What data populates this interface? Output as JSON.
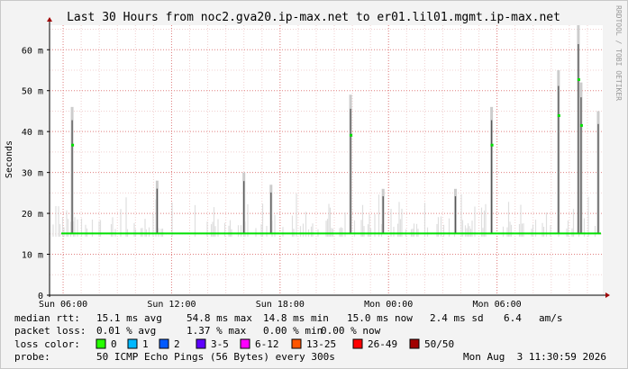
{
  "chart_data": {
    "type": "area",
    "title": "Last 30 Hours from noc2.gva20.ip-max.net to er01.lil01.mgmt.ip-max.net",
    "ylabel": "Seconds",
    "credit": "RRDTOOL / TOBI OETIKER",
    "ylim": [
      0,
      0.066
    ],
    "y_ticks": [
      {
        "value": 0,
        "label": "0"
      },
      {
        "value": 0.01,
        "label": "10 m"
      },
      {
        "value": 0.02,
        "label": "20 m"
      },
      {
        "value": 0.03,
        "label": "30 m"
      },
      {
        "value": 0.04,
        "label": "40 m"
      },
      {
        "value": 0.05,
        "label": "50 m"
      },
      {
        "value": 0.06,
        "label": "60 m"
      }
    ],
    "x_ticks": [
      {
        "hour": 0,
        "label": "Sun 06:00"
      },
      {
        "hour": 6,
        "label": "Sun 12:00"
      },
      {
        "hour": 12,
        "label": "Sun 18:00"
      },
      {
        "hour": 18,
        "label": "Mon 00:00"
      },
      {
        "hour": 24,
        "label": "Mon 06:00"
      }
    ],
    "x_range_hours": [
      -0.75,
      29.85
    ],
    "median_series": {
      "name": "median rtt",
      "color": "#00e000",
      "baseline": 0.0151
    },
    "spikes": [
      {
        "hour": 0.5,
        "value": 0.046
      },
      {
        "hour": 5.2,
        "value": 0.028
      },
      {
        "hour": 10.0,
        "value": 0.03
      },
      {
        "hour": 11.5,
        "value": 0.027
      },
      {
        "hour": 15.9,
        "value": 0.049
      },
      {
        "hour": 17.7,
        "value": 0.026
      },
      {
        "hour": 21.7,
        "value": 0.026
      },
      {
        "hour": 23.7,
        "value": 0.046
      },
      {
        "hour": 27.4,
        "value": 0.055
      },
      {
        "hour": 28.5,
        "value": 0.066
      },
      {
        "hour": 28.65,
        "value": 0.052
      },
      {
        "hour": 29.6,
        "value": 0.045
      }
    ]
  },
  "legend": {
    "median_rtt": {
      "label": "median rtt:",
      "avg": "15.1 ms avg",
      "max": "54.8 ms max",
      "min": "14.8 ms min",
      "now": "15.0 ms now",
      "sd": "2.4 ms sd",
      "am": "6.4",
      "am_unit": "am/s"
    },
    "packet_loss": {
      "label": "packet loss:",
      "avg": "0.01 % avg",
      "max": "1.37 % max",
      "min": "0.00 % min",
      "now": "0.00 % now"
    },
    "loss_color": {
      "label": "loss color:",
      "items": [
        {
          "label": "0",
          "color": "#26ff00"
        },
        {
          "label": "1",
          "color": "#00b8ff"
        },
        {
          "label": "2",
          "color": "#0059ff"
        },
        {
          "label": "3-5",
          "color": "#5e00ff"
        },
        {
          "label": "6-12",
          "color": "#ff00ff"
        },
        {
          "label": "13-25",
          "color": "#ff5500"
        },
        {
          "label": "26-49",
          "color": "#ff0000"
        },
        {
          "label": "50/50",
          "color": "#a10000"
        }
      ]
    },
    "probe": {
      "label": "probe:",
      "text": "50 ICMP Echo Pings (56 Bytes) every 300s",
      "timestamp": "Mon Aug  3 11:30:59 2026"
    }
  }
}
